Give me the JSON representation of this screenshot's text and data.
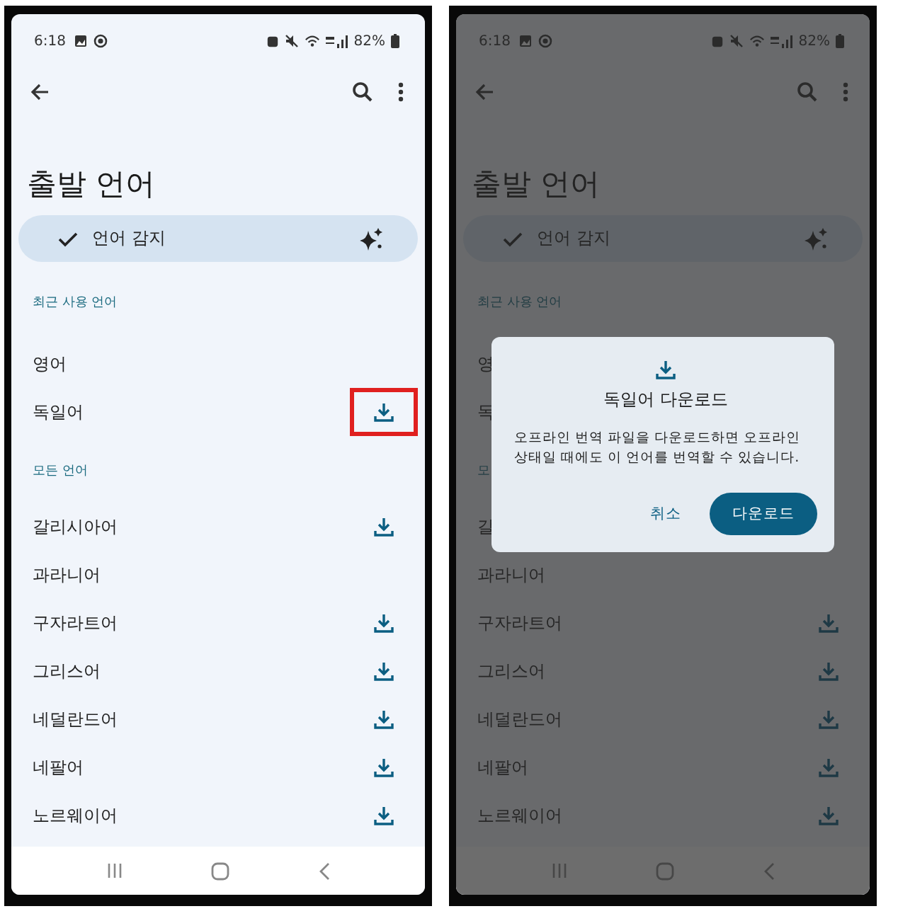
{
  "screens": [
    {
      "status_bar": {
        "time": "6:18",
        "battery": "82%"
      },
      "title": "출발 언어",
      "detect_chip": {
        "label": "언어 감지",
        "checked": true
      },
      "recent_header": "최근 사용 언어",
      "recent": [
        {
          "label": "영어",
          "download": false,
          "highlighted": false
        },
        {
          "label": "독일어",
          "download": true,
          "highlighted": true
        }
      ],
      "all_header": "모든 언어",
      "all": [
        {
          "label": "갈리시아어",
          "download": true
        },
        {
          "label": "과라니어",
          "download": false
        },
        {
          "label": "구자라트어",
          "download": true
        },
        {
          "label": "그리스어",
          "download": true
        },
        {
          "label": "네덜란드어",
          "download": true
        },
        {
          "label": "네팔어",
          "download": true
        },
        {
          "label": "노르웨이어",
          "download": true
        }
      ],
      "dimmed": false
    },
    {
      "status_bar": {
        "time": "6:18",
        "battery": "82%"
      },
      "title": "출발 언어",
      "detect_chip": {
        "label": "언어 감지",
        "checked": true
      },
      "recent_header": "최근 사용 언어",
      "recent": [
        {
          "label": "영",
          "download": false,
          "highlighted": false
        },
        {
          "label": "독",
          "download": false,
          "highlighted": false
        }
      ],
      "all_header": "모",
      "all": [
        {
          "label": "갈",
          "download": false
        },
        {
          "label": "과라니어",
          "download": false
        },
        {
          "label": "구자라트어",
          "download": true
        },
        {
          "label": "그리스어",
          "download": true
        },
        {
          "label": "네덜란드어",
          "download": true
        },
        {
          "label": "네팔어",
          "download": true
        },
        {
          "label": "노르웨이어",
          "download": true
        }
      ],
      "dimmed": true,
      "dialog": {
        "title": "독일어 다운로드",
        "message": "오프라인 번역 파일을 다운로드하면 오프라인 상태일 때에도 이 언어를 번역할 수 있습니다.",
        "buttons": [
          {
            "label": "취소",
            "kind": "text"
          },
          {
            "label": "다운로드",
            "kind": "filled"
          }
        ]
      }
    }
  ]
}
